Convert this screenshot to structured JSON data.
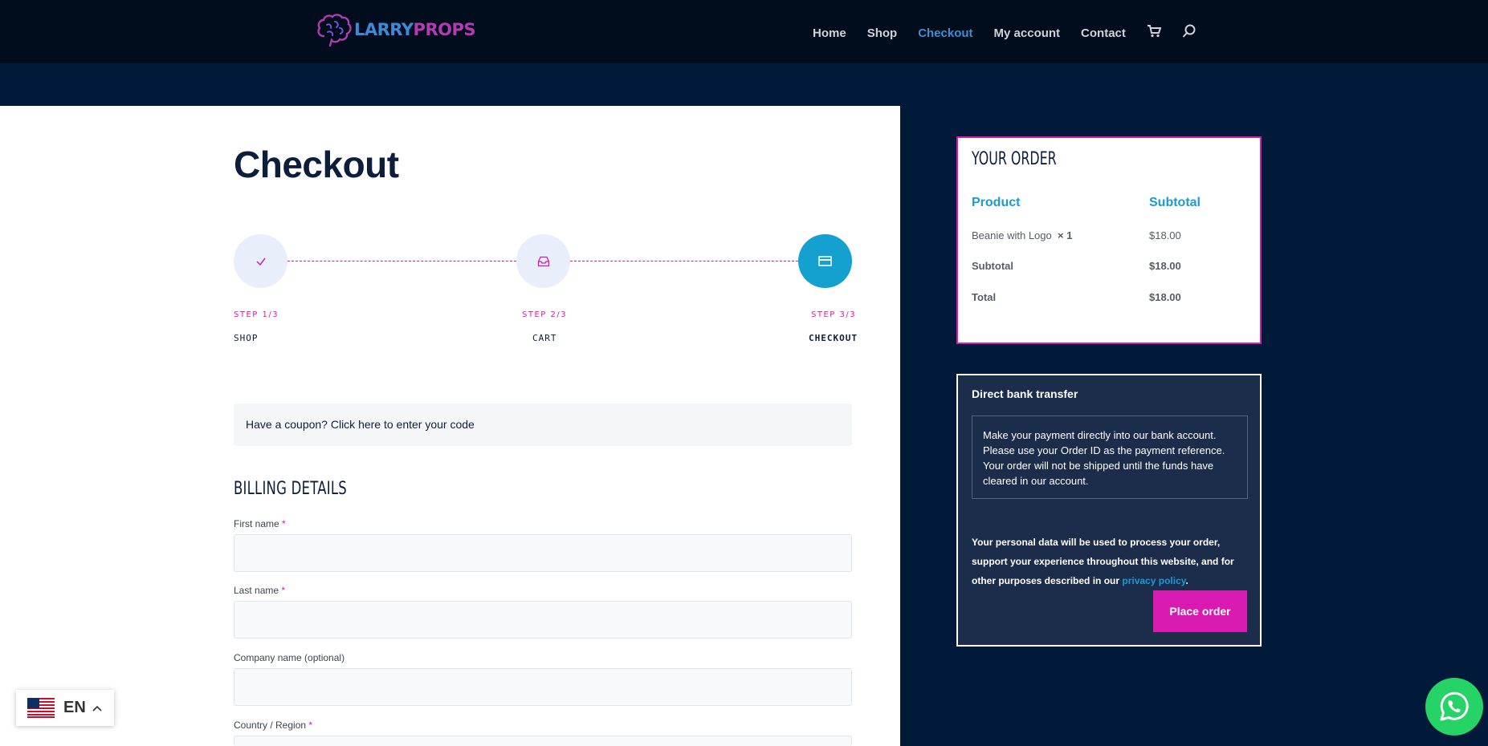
{
  "header": {
    "logo": {
      "part1": "LARRY",
      "part2": "PROPS"
    },
    "nav": [
      {
        "label": "Home",
        "active": false
      },
      {
        "label": "Shop",
        "active": false
      },
      {
        "label": "Checkout",
        "active": true
      },
      {
        "label": "My account",
        "active": false
      },
      {
        "label": "Contact",
        "active": false
      }
    ],
    "icons": [
      "cart-icon",
      "search-icon"
    ]
  },
  "page": {
    "title": "Checkout"
  },
  "stepper": {
    "steps": [
      {
        "num": "STEP 1/3",
        "name": "SHOP",
        "icon": "check-icon",
        "state": "done"
      },
      {
        "num": "STEP 2/3",
        "name": "CART",
        "icon": "inbox-icon",
        "state": "done"
      },
      {
        "num": "STEP 3/3",
        "name": "CHECKOUT",
        "icon": "credit-card-icon",
        "state": "current"
      }
    ]
  },
  "coupon": {
    "text": "Have a coupon? Click here to enter your code"
  },
  "billing": {
    "title": "BILLING DETAILS",
    "fields": [
      {
        "label": "First name",
        "required": "*",
        "value": ""
      },
      {
        "label": "Last name",
        "required": "*",
        "value": ""
      },
      {
        "label": "Company name (optional)",
        "required": "",
        "value": ""
      },
      {
        "label": "Country / Region",
        "required": "*",
        "value": ""
      }
    ]
  },
  "order": {
    "title": "YOUR ORDER",
    "col_product": "Product",
    "col_subtotal": "Subtotal",
    "item_name": "Beanie with Logo",
    "item_qty": "× 1",
    "item_price": "$18.00",
    "subtotal_label": "Subtotal",
    "subtotal_value": "$18.00",
    "total_label": "Total",
    "total_value": "$18.00"
  },
  "payment": {
    "method": "Direct bank transfer",
    "description": "Make your payment directly into our bank account. Please use your Order ID as the payment reference. Your order will not be shipped until the funds have cleared in our account.",
    "privacy_text": "Your personal data will be used to process your order, support your experience throughout this website, and for other purposes described in our",
    "privacy_link": "privacy policy",
    "privacy_end": ".",
    "place_order": "Place order"
  },
  "language": {
    "code": "EN"
  },
  "colors": {
    "accent": "#d81ab0",
    "link": "#1b9ad3",
    "navy": "#021a3a",
    "header": "#010c1c",
    "whatsapp": "#25d366"
  }
}
